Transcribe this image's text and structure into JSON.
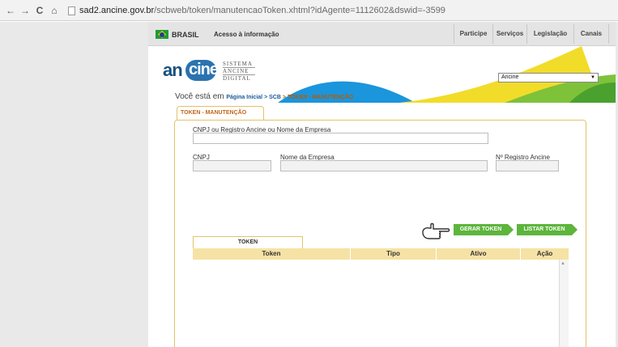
{
  "browser": {
    "back": "←",
    "forward": "→",
    "reload": "C",
    "home": "⌂",
    "url_domain": "sad2.ancine.gov.br",
    "url_path": "/scbweb/token/manutencaoToken.xhtml?idAgente=1112602&dswid=-3599"
  },
  "gov_bar": {
    "country": "BRASIL",
    "access_info": "Acesso à informação",
    "links": [
      "Participe",
      "Serviços",
      "Legislação",
      "Canais"
    ]
  },
  "header": {
    "logo_an": "an",
    "logo_cine": "cine",
    "system_lines": [
      "SISTEMA",
      "ANCINE",
      "DIGITAL"
    ],
    "agency_select": "Ancine"
  },
  "breadcrumb": {
    "prefix": "Você está em",
    "home": "Página Inicial",
    "separator1": " > ",
    "module": "SCB",
    "separator2": " > ",
    "current": "TOKEN - MANUTENÇÃO"
  },
  "panel": {
    "tab_title": "TOKEN - MANUTENÇÃO",
    "search_label": "CNPJ ou Registro Ancine ou Nome da Empresa",
    "search_value": "",
    "cnpj_label": "CNPJ",
    "cnpj_value": "",
    "company_label": "Nome da Empresa",
    "company_value": "",
    "registro_label": "Nº Registro Ancine",
    "registro_value": ""
  },
  "actions": {
    "generate": "GERAR TOKEN",
    "list": "LISTAR TOKEN"
  },
  "token_grid": {
    "tab": "TOKEN",
    "columns": [
      "Token",
      "Tipo",
      "Ativo",
      "Ação"
    ],
    "rows": []
  },
  "colors": {
    "accent_orange": "#c0661a",
    "panel_border": "#e4c26a",
    "button_green": "#5db53c",
    "header_blue": "#1b95dc",
    "header_yellow": "#f2dc2a",
    "header_green": "#7ec23a"
  }
}
